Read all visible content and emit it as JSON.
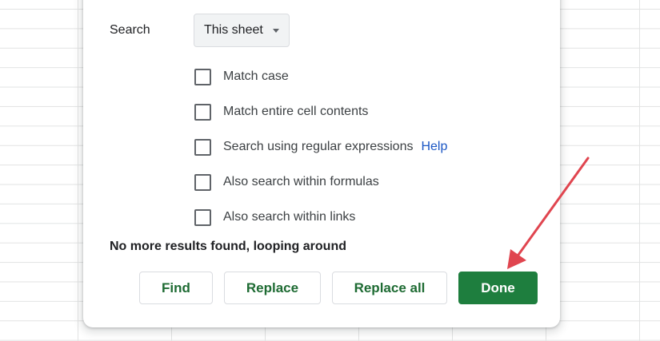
{
  "dialog": {
    "search": {
      "label": "Search",
      "selected": "This sheet"
    },
    "options": [
      {
        "label": "Match case",
        "checked": false
      },
      {
        "label": "Match entire cell contents",
        "checked": false
      },
      {
        "label": "Search using regular expressions",
        "checked": false,
        "help": "Help"
      },
      {
        "label": "Also search within formulas",
        "checked": false
      },
      {
        "label": "Also search within links",
        "checked": false
      }
    ],
    "status": "No more results found, looping around",
    "buttons": {
      "find": "Find",
      "replace": "Replace",
      "replace_all": "Replace all",
      "done": "Done"
    }
  },
  "colors": {
    "primary_button": "#1e7e3e",
    "button_text": "#1e6b33",
    "link": "#1a56c4",
    "annotation_arrow": "#e0454f"
  },
  "annotation": {
    "icon": "arrow-icon",
    "target": "done-button"
  }
}
